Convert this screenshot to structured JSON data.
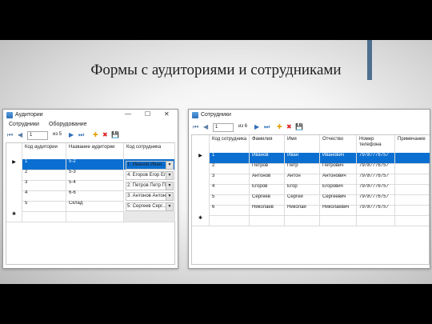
{
  "slide": {
    "title": "Формы с аудиториями и сотрудниками"
  },
  "auditorii": {
    "title": "Аудитории",
    "menu": [
      "Сотрудники",
      "Оборудование"
    ],
    "toolbar": {
      "position": "1",
      "of": "из 5"
    },
    "columns": [
      "Код аудитории",
      "Название аудитории",
      "Код сотрудника"
    ],
    "rows": [
      [
        "1",
        "5-2",
        "1: Иванов Иван ..."
      ],
      [
        "2",
        "5-3",
        "4: Егоров Егор Ег..."
      ],
      [
        "3",
        "5-4",
        "2: Петров Петр П..."
      ],
      [
        "4",
        "6-6",
        "3: Антонов Антон ..."
      ],
      [
        "5",
        "Склад",
        "5: Сергеев Серг..."
      ]
    ]
  },
  "sotrudniki": {
    "title": "Сотрудники",
    "toolbar": {
      "position": "1",
      "of": "из 6"
    },
    "columns": [
      "Код сотрудника",
      "Фамилия",
      "Имя",
      "Отчество",
      "Номер телефона",
      "Примечание"
    ],
    "rows": [
      [
        "1",
        "Иванов",
        "Иван",
        "Иванович",
        "79787776757",
        ""
      ],
      [
        "2",
        "Петров",
        "Петр",
        "Петрович",
        "79787776757",
        ""
      ],
      [
        "3",
        "Антонов",
        "Антон",
        "Антонович",
        "79787776757",
        ""
      ],
      [
        "4",
        "Егоров",
        "Егор",
        "Егорович",
        "79787776757",
        ""
      ],
      [
        "5",
        "Сергеев",
        "Сергей",
        "Сергеевич",
        "79787776757",
        ""
      ],
      [
        "6",
        "Николаев",
        "Николай",
        "Николаевич",
        "79787776757",
        ""
      ]
    ]
  },
  "icons": {
    "first": "⏮",
    "prev": "◀",
    "next": "▶",
    "last": "⏭",
    "add": "✚",
    "delete": "✖",
    "save": "💾",
    "minimize": "—",
    "maximize": "☐",
    "close": "✕",
    "row_pointer": "▶",
    "new_row": "✱",
    "dropdown": "▼"
  },
  "colors": {
    "selection": "#0b6fd1",
    "accent_bar": "#4e6f8f",
    "add_icon": "#e0a100",
    "delete_icon": "#d22"
  }
}
